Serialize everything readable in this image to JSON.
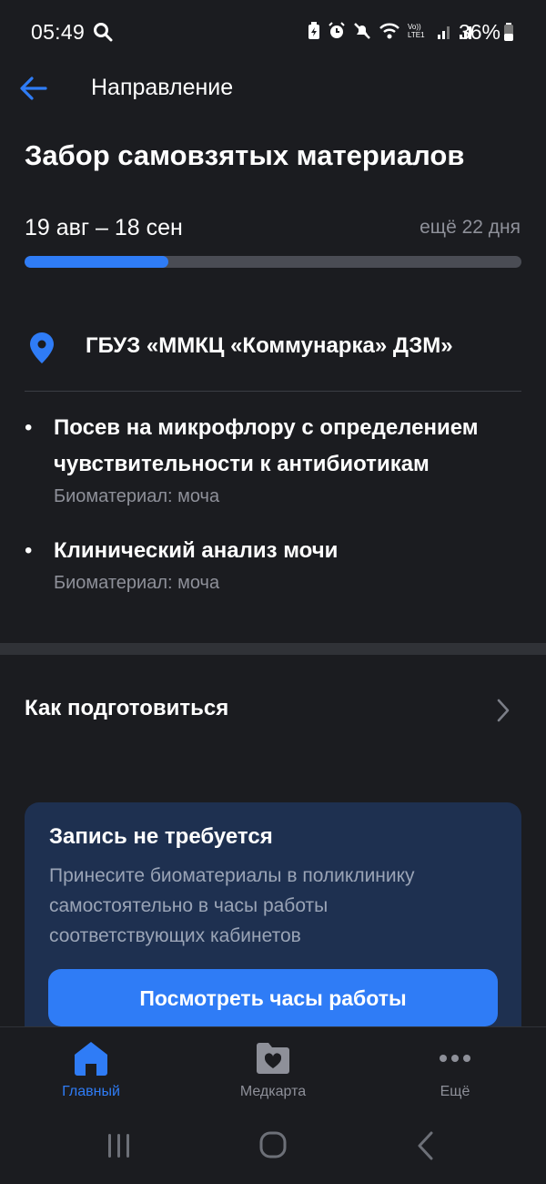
{
  "status_bar": {
    "time": "05:49",
    "battery": "36%",
    "icons": [
      "search-icon",
      "battery-saver-icon",
      "alarm-icon",
      "mute-icon",
      "wifi-icon",
      "volte-icon",
      "signal-icon",
      "signal-roaming-icon",
      "battery-icon"
    ],
    "volte_label": "Vo)) LTE1"
  },
  "header": {
    "title": "Направление"
  },
  "referral": {
    "title": "Забор самовзятых материалов",
    "dates": "19 авг – 18 сен",
    "remaining": "ещё 22 дня",
    "progress": 0.29,
    "location": "ГБУЗ «ММКЦ «Коммунарка» ДЗМ»",
    "tests": [
      {
        "name": "Посев на микрофлору с определением чувствительности к антибиотикам",
        "biomaterial": "Биоматериал: моча"
      },
      {
        "name": "Клинический анализ мочи",
        "biomaterial": "Биоматериал: моча"
      }
    ]
  },
  "howto": {
    "label": "Как подготовиться"
  },
  "info_card": {
    "title": "Запись не требуется",
    "text": "Принесите биоматериалы в поликлинику самостоятельно в часы работы соответствующих кабинетов",
    "button": "Посмотреть часы работы"
  },
  "bottom_nav": {
    "items": [
      {
        "label": "Главный",
        "icon": "home-icon",
        "active": true
      },
      {
        "label": "Медкарта",
        "icon": "folder-heart-icon",
        "active": false
      },
      {
        "label": "Ещё",
        "icon": "more-icon",
        "active": false
      }
    ]
  },
  "colors": {
    "background": "#1b1c20",
    "accent": "#2f7cf6",
    "muted_text": "#8e9099",
    "card": "#1e3050"
  }
}
